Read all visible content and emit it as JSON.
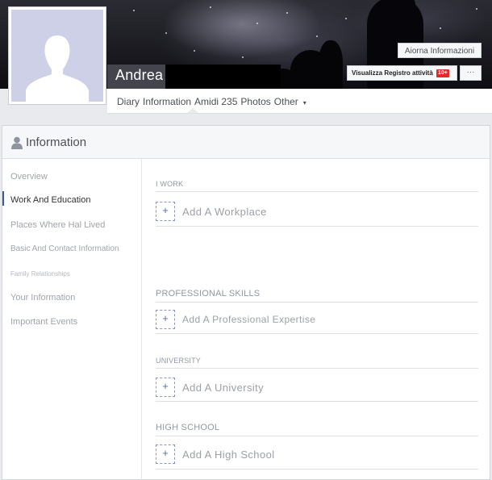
{
  "profile": {
    "name": "Andrea",
    "update_info_label": "Aiorna Informazioni",
    "activity_log_label": "Visualizza Registro attività",
    "activity_badge": "10+",
    "more_label": "···"
  },
  "tabs": [
    {
      "label": "Diary"
    },
    {
      "label": "Information"
    },
    {
      "label": "Amidi 235"
    },
    {
      "label": "Photos"
    },
    {
      "label": "Other"
    }
  ],
  "tab_caret": "▾",
  "panel": {
    "title": "Information"
  },
  "sidebar": {
    "items": [
      {
        "label": "Overview"
      },
      {
        "label": "Work And Education"
      },
      {
        "label": "Places Where Hal Lived"
      },
      {
        "label": "Basic And Contact Information"
      },
      {
        "label": "Family Relationships"
      },
      {
        "label": "Your Information"
      },
      {
        "label": "Important Events"
      }
    ]
  },
  "sections": [
    {
      "title": "I WORK",
      "add_label": "Add A Workplace"
    },
    {
      "title": "PROFESSIONAL SKILLS",
      "add_label": "Add A Professional Expertise"
    },
    {
      "title": "UNIVERSITY",
      "add_label": "Add A University"
    },
    {
      "title": "HIGH SCHOOL",
      "add_label": "Add A High School"
    }
  ],
  "plus_symbol": "+",
  "colors": {
    "accent": "#3b5998",
    "badge": "#e02a2a",
    "avatar_bg": "#cdd0e6"
  }
}
